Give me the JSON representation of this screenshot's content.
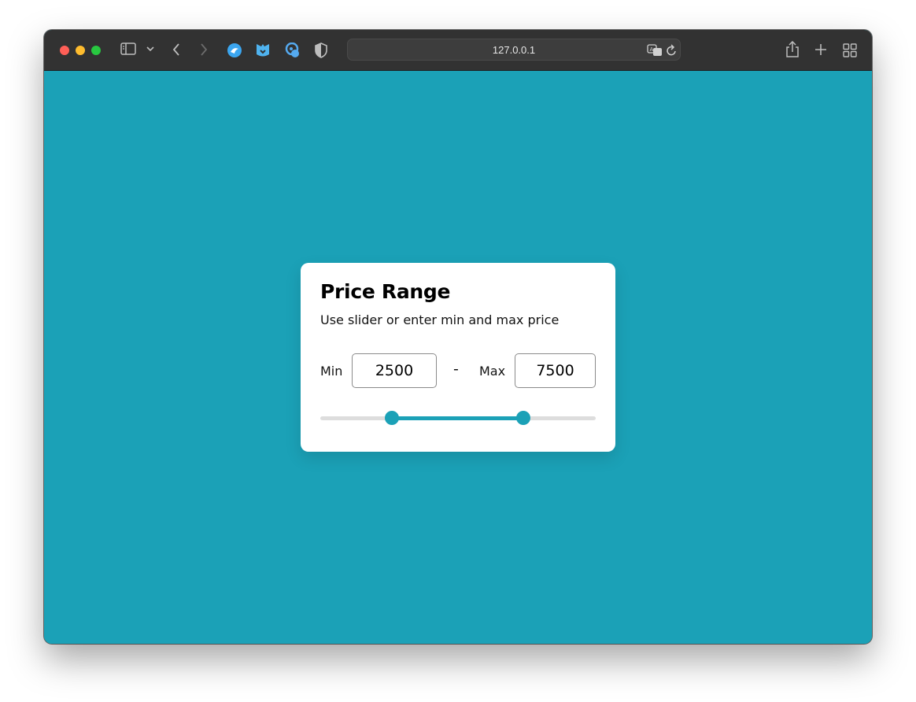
{
  "browser": {
    "url": "127.0.0.1",
    "icons": [
      "sidebar-icon",
      "chevron-down-icon",
      "back-icon",
      "forward-icon",
      "extension-icon",
      "extension-icon",
      "extension-icon",
      "shield-icon",
      "translate-icon",
      "reload-icon",
      "share-icon",
      "new-tab-icon",
      "tab-overview-icon"
    ]
  },
  "colors": {
    "page_background": "#1ba1b7",
    "accent": "#1ba1b7",
    "track": "#dddddd"
  },
  "card": {
    "title": "Price Range",
    "subtitle": "Use slider or enter min and max price",
    "min_label": "Min",
    "max_label": "Max",
    "separator": "-",
    "min_value": "2500",
    "max_value": "7500"
  },
  "slider": {
    "range_min": 0,
    "range_max": 10000,
    "low": 2500,
    "high": 7500
  }
}
